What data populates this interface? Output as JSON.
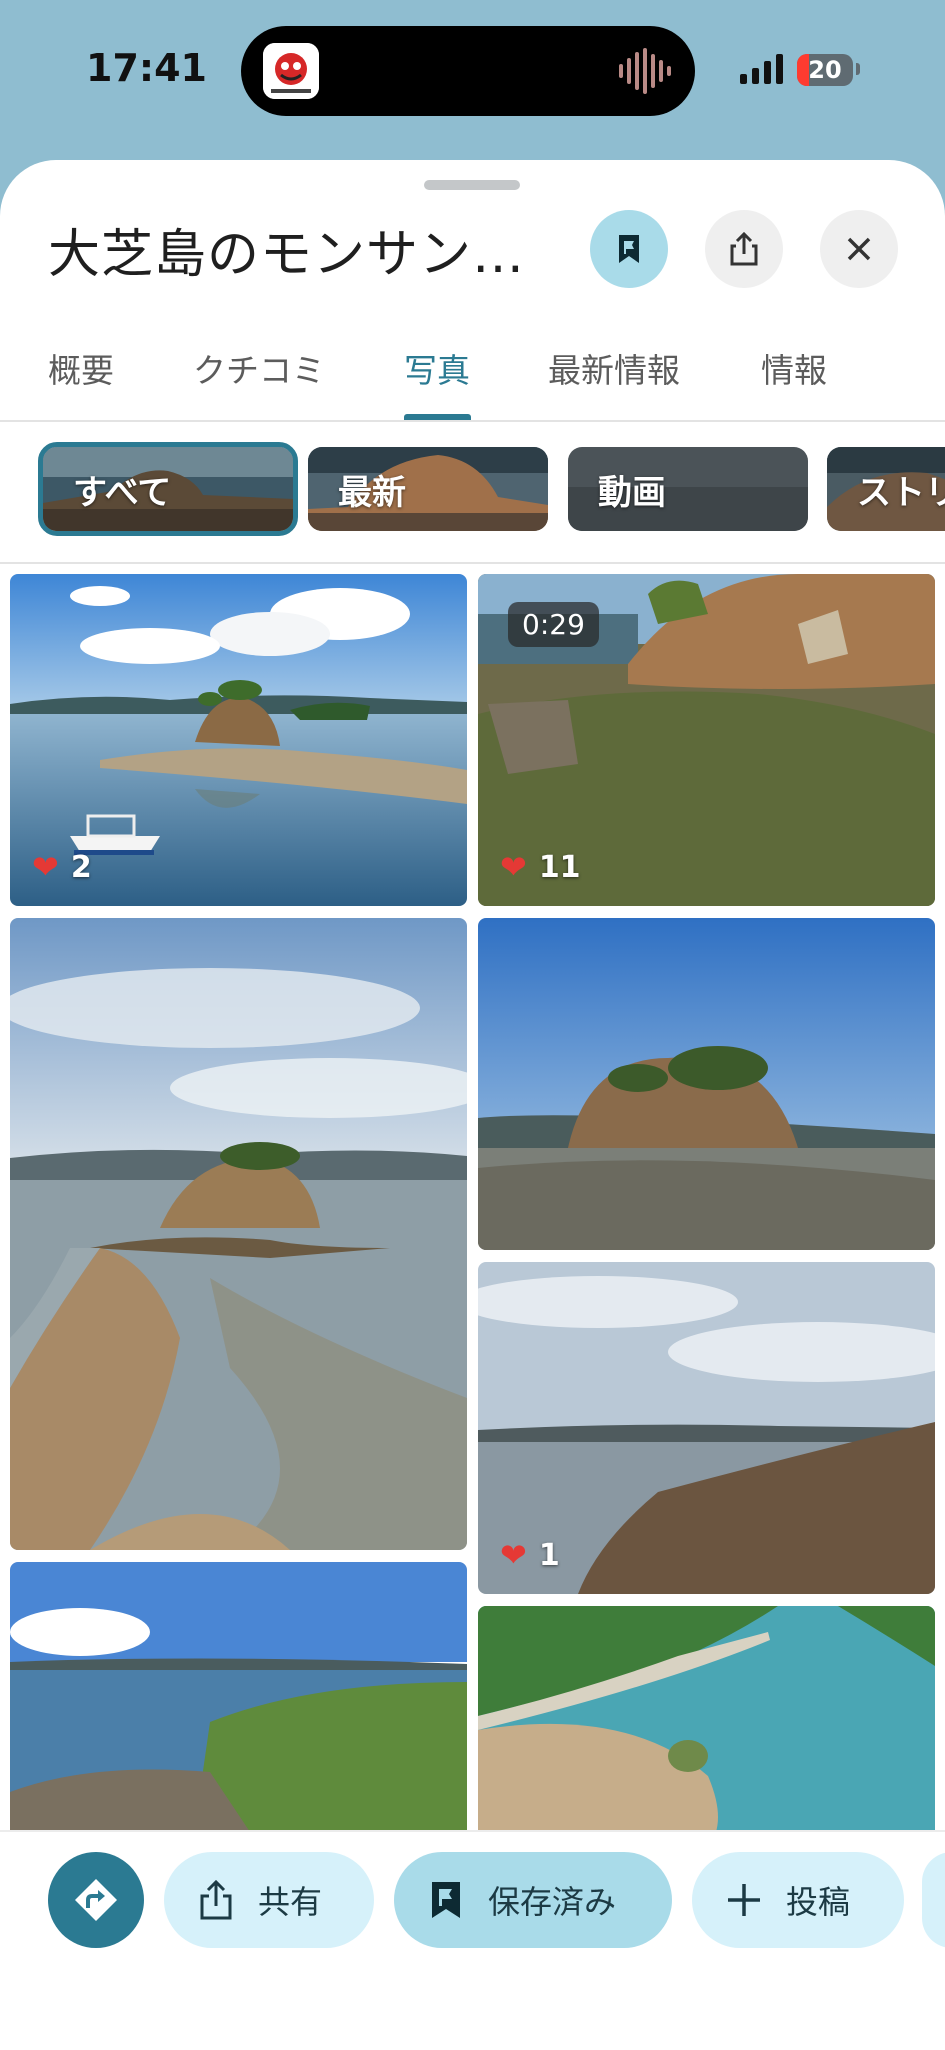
{
  "status_bar": {
    "time": "17:41",
    "battery_level": "20"
  },
  "sheet": {
    "title": "大芝島のモンサン…",
    "header_icons": [
      "bookmark-flag-icon",
      "share-icon",
      "close-icon"
    ]
  },
  "tabs": [
    {
      "label": "概要",
      "active": false
    },
    {
      "label": "クチコミ",
      "active": false
    },
    {
      "label": "写真",
      "active": true
    },
    {
      "label": "最新情報",
      "active": false
    },
    {
      "label": "情報",
      "active": false
    }
  ],
  "filter_chips": [
    {
      "label": "すべて",
      "selected": true
    },
    {
      "label": "最新",
      "selected": false
    },
    {
      "label": "動画",
      "selected": false
    },
    {
      "label": "ストリ",
      "selected": false
    }
  ],
  "photos": [
    {
      "likes": "2"
    },
    {
      "likes": "11",
      "duration": "0:29"
    },
    {},
    {},
    {
      "likes": "1"
    },
    {},
    {}
  ],
  "action_bar": {
    "share_label": "共有",
    "saved_label": "保存済み",
    "post_label": "投稿"
  },
  "colors": {
    "accent": "#2b7a92",
    "status_background": "#8fbdd0",
    "pill_background": "#d6f1fa"
  }
}
